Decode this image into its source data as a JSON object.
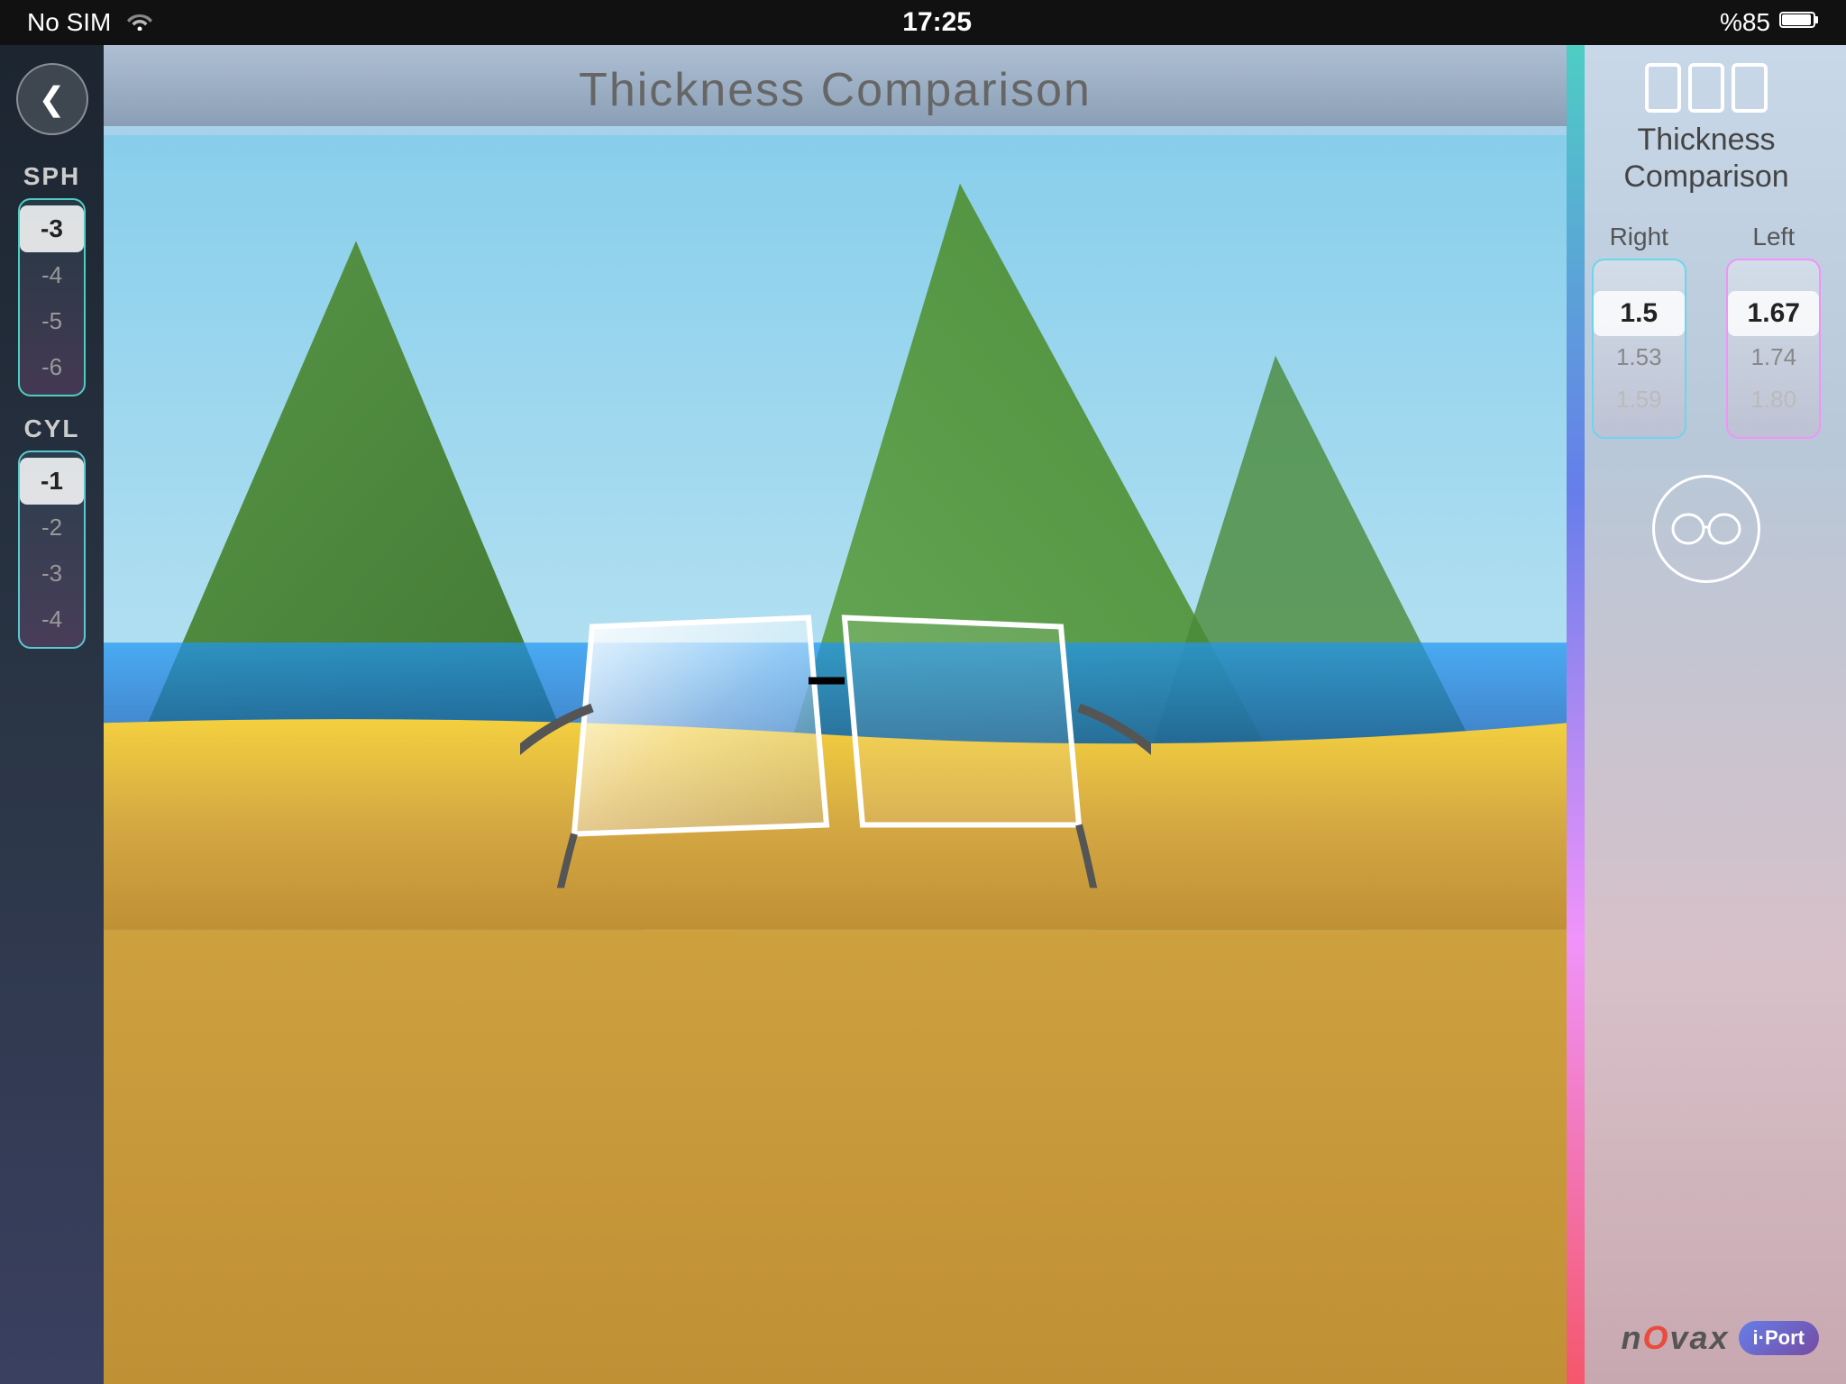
{
  "statusBar": {
    "carrier": "No SIM",
    "time": "17:25",
    "battery": "%85"
  },
  "header": {
    "title": "Thickness Comparison"
  },
  "sidebar": {
    "sphLabel": "SPH",
    "cylLabel": "CYL",
    "sphValues": [
      "-3",
      "-4",
      "-5",
      "-6"
    ],
    "sphSelected": "-3",
    "cylValues": [
      "-1",
      "-2",
      "-3",
      "-4"
    ],
    "cylSelected": "-1"
  },
  "rightPanel": {
    "title": "Thickness\nComparison",
    "rightLabel": "Right",
    "leftLabel": "Left",
    "rightValues": [
      "1.5",
      "1.53",
      "1.59"
    ],
    "rightSelected": "1.5",
    "leftValues": [
      "1.67",
      "1.74",
      "1.80"
    ],
    "leftSelected": "1.67"
  },
  "logo": {
    "novax": "nOvax",
    "iport": "i·Port"
  },
  "icons": {
    "back": "❮",
    "glasses": "👓"
  }
}
